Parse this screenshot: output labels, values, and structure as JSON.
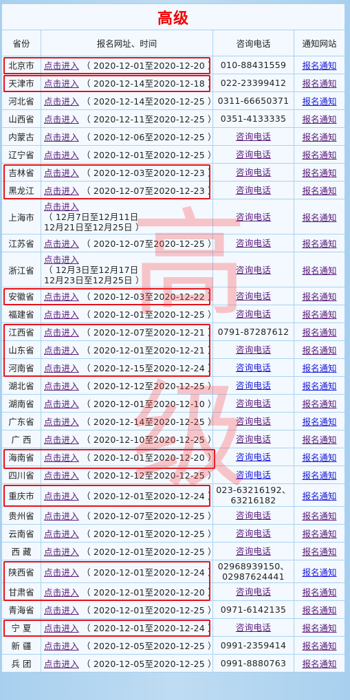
{
  "title": "高级",
  "watermark": [
    "高",
    "级"
  ],
  "headers": {
    "province": "省份",
    "registration": "报名网址、时间",
    "phone": "咨询电话",
    "notice": "通知网站"
  },
  "link_labels": {
    "enter": "点击进入",
    "phone_link": "咨询电话",
    "notice_link": "报名通知"
  },
  "rows": [
    {
      "province": "北京市",
      "period": "（ 2020-12-01至2020-12-20 ）",
      "phone": "010-88431559",
      "highlighted": true
    },
    {
      "province": "天津市",
      "period": "（ 2020-12-14至2020-12-18 ）",
      "phone": "022-23399412",
      "highlighted": true
    },
    {
      "province": "河北省",
      "period": "（ 2020-12-14至2020-12-25 ）",
      "phone": "0311-66650371",
      "highlighted": false
    },
    {
      "province": "山西省",
      "period": "（ 2020-12-11至2020-12-25 ）",
      "phone": "0351-4133335",
      "highlighted": false
    },
    {
      "province": "内蒙古",
      "period": "（ 2020-12-06至2020-12-25 ）",
      "phone": null,
      "highlighted": false
    },
    {
      "province": "辽宁省",
      "period": "（ 2020-12-01至2020-12-25 ）",
      "phone": null,
      "highlighted": false
    },
    {
      "province": "吉林省",
      "period": "（ 2020-12-03至2020-12-23 ）",
      "phone": null,
      "highlighted": true
    },
    {
      "province": "黑龙江",
      "period": "（ 2020-12-07至2020-12-23 ）",
      "phone": null,
      "highlighted": true
    },
    {
      "province": "上海市",
      "period_lines": [
        "（ 12月7日至12月11日",
        "12月21日至12月25日 ）"
      ],
      "phone": null,
      "highlighted": false
    },
    {
      "province": "江苏省",
      "period": "（ 2020-12-07至2020-12-25 ）",
      "phone": null,
      "highlighted": false
    },
    {
      "province": "浙江省",
      "period_lines": [
        "（ 12月3日至12月17日",
        "12月23日至12月25日 ）"
      ],
      "phone": null,
      "highlighted": false
    },
    {
      "province": "安徽省",
      "period": "（ 2020-12-03至2020-12-22 ）",
      "phone": null,
      "highlighted": true
    },
    {
      "province": "福建省",
      "period": "（ 2020-12-01至2020-12-25 ）",
      "phone": null,
      "highlighted": false
    },
    {
      "province": "江西省",
      "period": "（ 2020-12-07至2020-12-21 ）",
      "phone": "0791-87287612",
      "highlighted": true
    },
    {
      "province": "山东省",
      "period": "（ 2020-12-01至2020-12-21 ）",
      "phone": null,
      "highlighted": true
    },
    {
      "province": "河南省",
      "period": "（ 2020-12-15至2020-12-24 ）",
      "phone": null,
      "highlighted": true
    },
    {
      "province": "湖北省",
      "period": "（ 2020-12-12至2020-12-25 ）",
      "phone": null,
      "highlighted": false
    },
    {
      "province": "湖南省",
      "period": "（ 2020-12-01至2020-12-10 ）",
      "phone": null,
      "highlighted": false
    },
    {
      "province": "广东省",
      "period": "（ 2020-12-14至2020-12-25 ）",
      "phone": null,
      "highlighted": false
    },
    {
      "province": "广 西",
      "period": "（ 2020-12-10至2020-12-25 ）",
      "phone": null,
      "highlighted": false
    },
    {
      "province": "海南省",
      "period": "（ 2020-12-01至2020-12-20 ）",
      "phone": null,
      "highlighted": true
    },
    {
      "province": "四川省",
      "period": "（ 2020-12-12至2020-12-25 ）",
      "phone": null,
      "highlighted": false
    },
    {
      "province": "重庆市",
      "period": "（ 2020-12-01至2020-12-24 ）",
      "phone_lines": [
        "023-63216192、",
        "63216182"
      ],
      "highlighted": true
    },
    {
      "province": "贵州省",
      "period": "（ 2020-12-07至2020-12-25 ）",
      "phone": null,
      "highlighted": false
    },
    {
      "province": "云南省",
      "period": "（ 2020-12-01至2020-12-25 ）",
      "phone": null,
      "highlighted": false
    },
    {
      "province": "西 藏",
      "period": "（ 2020-12-01至2020-12-25 ）",
      "phone": null,
      "highlighted": false
    },
    {
      "province": "陕西省",
      "period": "（ 2020-12-01至2020-12-24 ）",
      "phone_lines": [
        "02968939150、",
        "02987624441"
      ],
      "highlighted": true
    },
    {
      "province": "甘肃省",
      "period": "（ 2020-12-01至2020-12-20 ）",
      "phone": null,
      "highlighted": true
    },
    {
      "province": "青海省",
      "period": "（ 2020-12-01至2020-12-25 ）",
      "phone": "0971-6142135",
      "highlighted": false
    },
    {
      "province": "宁 夏",
      "period": "（ 2020-12-01至2020-12-24 ）",
      "phone": null,
      "highlighted": true
    },
    {
      "province": "新 疆",
      "period": "（ 2020-12-05至2020-12-25 ）",
      "phone": "0991-2359414",
      "highlighted": false
    },
    {
      "province": "兵 团",
      "period": "（ 2020-12-05至2020-12-25 ）",
      "phone": "0991-8880763",
      "highlighted": false
    }
  ],
  "colors": {
    "title_red": "#f00000",
    "highlight_red": "#e8101a",
    "border_blue": "#a9d2f0",
    "link_visited": "#5a1a7a",
    "link_blue": "#1a1ad8"
  }
}
